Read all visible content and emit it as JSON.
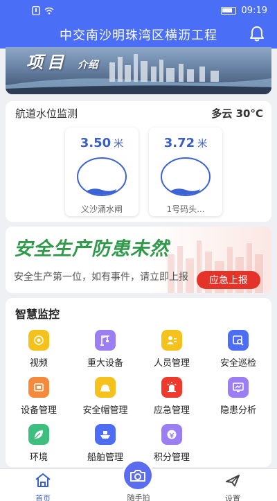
{
  "status": {
    "time": "09:19"
  },
  "header": {
    "title": "中交南沙明珠湾区横沥工程"
  },
  "banner": {
    "title_main": "项目",
    "title_sub": "介绍"
  },
  "water": {
    "title": "航道水位监测",
    "weather": "多云 30°C",
    "gauges": [
      {
        "value": "3.50",
        "unit": "米",
        "name": "义沙涌水闸"
      },
      {
        "value": "3.72",
        "unit": "米",
        "name": "1号码头..."
      }
    ]
  },
  "safety": {
    "slogan": "安全生产防患未然",
    "sub": "安全生产第一位，如有事件，请立即上报",
    "report_label": "应急上报"
  },
  "monitor": {
    "title": "智慧监控",
    "items": [
      {
        "label": "视频",
        "icon": "video-icon",
        "color": "#f5c21b"
      },
      {
        "label": "重大设备",
        "icon": "crane-icon",
        "color": "#9b7ff2"
      },
      {
        "label": "人员管理",
        "icon": "person-card-icon",
        "color": "#f5c21b"
      },
      {
        "label": "安全巡检",
        "icon": "inspection-icon",
        "color": "#4d6df5"
      },
      {
        "label": "设备管理",
        "icon": "device-icon",
        "color": "#f58a3c"
      },
      {
        "label": "安全帽管理",
        "icon": "helmet-icon",
        "color": "#f5c21b"
      },
      {
        "label": "应急管理",
        "icon": "alarm-icon",
        "color": "#ee3a2c"
      },
      {
        "label": "隐患分析",
        "icon": "analysis-icon",
        "color": "#9b7ff2"
      },
      {
        "label": "环境",
        "icon": "leaf-icon",
        "color": "#3fbf7f"
      },
      {
        "label": "船舶管理",
        "icon": "ship-icon",
        "color": "#4d6df5"
      },
      {
        "label": "积分管理",
        "icon": "points-icon",
        "color": "#9b7ff2"
      }
    ]
  },
  "nav": {
    "home": "首页",
    "camera": "随手拍",
    "settings": "设置"
  }
}
